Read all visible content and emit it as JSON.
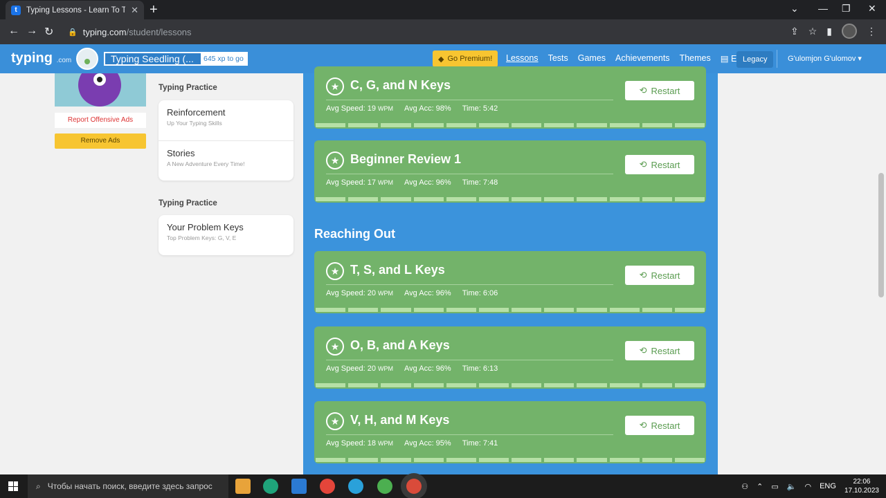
{
  "browser": {
    "tab_title": "Typing Lessons - Learn To Type /",
    "tab_close": "✕",
    "new_tab": "+",
    "url_domain": "typing.com",
    "url_path": "/student/lessons"
  },
  "header": {
    "logo": "typing",
    "logo_suffix": ".com",
    "rank_name": "Typing Seedling (...",
    "rank_xp": "645 xp to go",
    "premium_label": "Go Premium!",
    "nav": [
      "Lessons",
      "Tests",
      "Games",
      "Achievements",
      "Themes"
    ],
    "language": "EN",
    "legacy_label": "Legacy",
    "user_name": "G'ulomjon G'ulomov"
  },
  "ads": {
    "report": "Report Offensive Ads",
    "remove": "Remove Ads"
  },
  "practice": {
    "section1_label": "Typing Practice",
    "section1_items": [
      {
        "title": "Reinforcement",
        "subtitle": "Up Your Typing Skills"
      },
      {
        "title": "Stories",
        "subtitle": "A New Adventure Every Time!"
      }
    ],
    "section2_label": "Typing Practice",
    "section2_items": [
      {
        "title": "Your Problem Keys",
        "subtitle": "Top Problem Keys: G, V, E"
      }
    ]
  },
  "lessons": {
    "restart_label": "Restart",
    "group_title": "Reaching Out",
    "items": [
      {
        "name": "C, G, and N Keys",
        "speed": "Avg Speed: 19",
        "unit": "WPM",
        "acc": "Avg Acc: 98%",
        "time": "Time: 5:42"
      },
      {
        "name": "Beginner Review 1",
        "speed": "Avg Speed: 17",
        "unit": "WPM",
        "acc": "Avg Acc: 96%",
        "time": "Time: 7:48"
      },
      {
        "name": "T, S, and L Keys",
        "speed": "Avg Speed: 20",
        "unit": "WPM",
        "acc": "Avg Acc: 96%",
        "time": "Time: 6:06"
      },
      {
        "name": "O, B, and A Keys",
        "speed": "Avg Speed: 20",
        "unit": "WPM",
        "acc": "Avg Acc: 96%",
        "time": "Time: 6:13"
      },
      {
        "name": "V, H, and M Keys",
        "speed": "Avg Speed: 18",
        "unit": "WPM",
        "acc": "Avg Acc: 95%",
        "time": "Time: 7:41"
      }
    ]
  },
  "taskbar": {
    "search_placeholder": "Чтобы начать поиск, введите здесь запрос",
    "lang": "ENG",
    "time": "22:06",
    "date": "17.10.2023"
  },
  "colors": {
    "brand_blue": "#3a8fd9",
    "lesson_green": "#73b36a",
    "premium_yellow": "#f7c531"
  }
}
